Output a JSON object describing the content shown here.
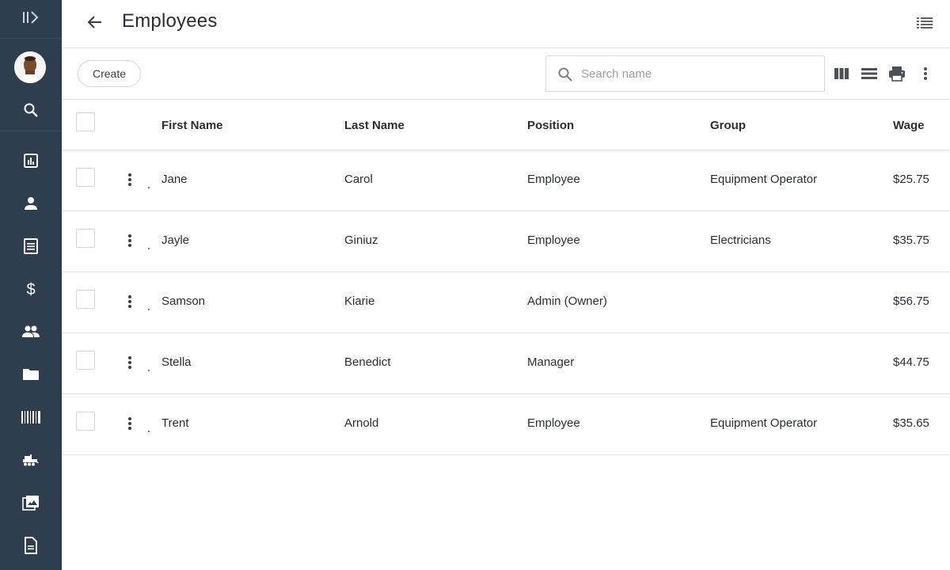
{
  "header": {
    "title": "Employees"
  },
  "toolbar": {
    "create_label": "Create",
    "search_placeholder": "Search name",
    "search_value": ""
  },
  "table": {
    "columns": {
      "first_name": "First Name",
      "last_name": "Last Name",
      "position": "Position",
      "group": "Group",
      "wage": "Wage"
    },
    "rows": [
      {
        "first_name": "Jane",
        "last_name": "Carol",
        "position": "Employee",
        "group": "Equipment Operator",
        "wage": "$25.75"
      },
      {
        "first_name": "Jayle",
        "last_name": "Giniuz",
        "position": "Employee",
        "group": "Electricians",
        "wage": "$35.75"
      },
      {
        "first_name": "Samson",
        "last_name": "Kiarie",
        "position": "Admin (Owner)",
        "group": "",
        "wage": "$56.75"
      },
      {
        "first_name": "Stella",
        "last_name": "Benedict",
        "position": "Manager",
        "group": "",
        "wage": "$44.75"
      },
      {
        "first_name": "Trent",
        "last_name": "Arnold",
        "position": "Employee",
        "group": "Equipment Operator",
        "wage": "$35.65"
      }
    ]
  },
  "sidebar": {
    "icons": [
      "expand-sidebar-icon",
      "avatar",
      "search-icon",
      "reports-icon",
      "person-icon",
      "document-icon",
      "dollar-icon",
      "people-icon",
      "folder-icon",
      "barcode-icon",
      "equipment-icon",
      "photos-icon",
      "file-icon"
    ]
  },
  "colors": {
    "sidebar_bg": "#2e3e4e",
    "sidebar_icon": "#ffffff",
    "text": "#2b2f33",
    "divider": "#e3e3e3"
  }
}
